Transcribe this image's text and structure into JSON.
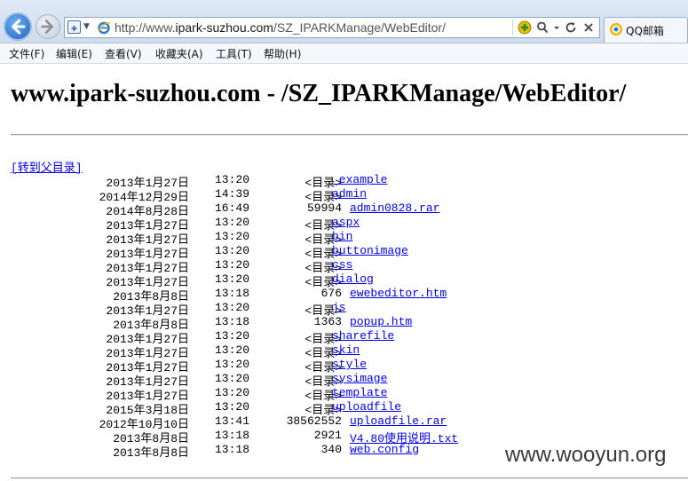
{
  "browser": {
    "url_prefix": "http://www.",
    "url_domain": "ipark-suzhou.com",
    "url_path": "/SZ_IPARKManage/WebEditor/",
    "tab_label": "QQ邮箱",
    "icons": [
      "back-arrow-icon",
      "forward-arrow-icon",
      "compat-view-icon",
      "ie-logo-icon",
      "add-favorite-icon",
      "search-icon",
      "refresh-icon",
      "close-icon",
      "qq-mail-icon"
    ]
  },
  "menu": {
    "items": [
      "文件(F)",
      "编辑(E)",
      "查看(V)",
      "收藏夹(A)",
      "工具(T)",
      "帮助(H)"
    ]
  },
  "page": {
    "title": "www.ipark-suzhou.com - /SZ_IPARKManage/WebEditor/",
    "parent_link": "[转到父目录]",
    "entries": [
      {
        "date": "2013年1月27日",
        "time": "13:20",
        "size": "<目录>",
        "name": "_example"
      },
      {
        "date": "2014年12月29日",
        "time": "14:39",
        "size": "<目录>",
        "name": "admin"
      },
      {
        "date": "2014年8月28日",
        "time": "16:49",
        "size": "59994",
        "name": "admin0828.rar"
      },
      {
        "date": "2013年1月27日",
        "time": "13:20",
        "size": "<目录>",
        "name": "aspx"
      },
      {
        "date": "2013年1月27日",
        "time": "13:20",
        "size": "<目录>",
        "name": "bin"
      },
      {
        "date": "2013年1月27日",
        "time": "13:20",
        "size": "<目录>",
        "name": "buttonimage"
      },
      {
        "date": "2013年1月27日",
        "time": "13:20",
        "size": "<目录>",
        "name": "css"
      },
      {
        "date": "2013年1月27日",
        "time": "13:20",
        "size": "<目录>",
        "name": "dialog"
      },
      {
        "date": "2013年8月8日",
        "time": "13:18",
        "size": "676",
        "name": "ewebeditor.htm"
      },
      {
        "date": "2013年1月27日",
        "time": "13:20",
        "size": "<目录>",
        "name": "js"
      },
      {
        "date": "2013年8月8日",
        "time": "13:18",
        "size": "1363",
        "name": "popup.htm"
      },
      {
        "date": "2013年1月27日",
        "time": "13:20",
        "size": "<目录>",
        "name": "sharefile"
      },
      {
        "date": "2013年1月27日",
        "time": "13:20",
        "size": "<目录>",
        "name": "skin"
      },
      {
        "date": "2013年1月27日",
        "time": "13:20",
        "size": "<目录>",
        "name": "style"
      },
      {
        "date": "2013年1月27日",
        "time": "13:20",
        "size": "<目录>",
        "name": "sysimage"
      },
      {
        "date": "2013年1月27日",
        "time": "13:20",
        "size": "<目录>",
        "name": "template"
      },
      {
        "date": "2015年3月18日",
        "time": "13:20",
        "size": "<目录>",
        "name": "uploadfile"
      },
      {
        "date": "2012年10月10日",
        "time": "13:41",
        "size": "38562552",
        "name": "uploadfile.rar"
      },
      {
        "date": "2013年8月8日",
        "time": "13:18",
        "size": "2921",
        "name": "V4.80使用说明.txt"
      },
      {
        "date": "2013年8月8日",
        "time": "13:18",
        "size": "340",
        "name": "web.config"
      }
    ]
  },
  "watermark": "www.wooyun.org",
  "colors": {
    "link": "#0000ee",
    "chrome": "#dfe9f5",
    "accent": "#1d63c2"
  }
}
